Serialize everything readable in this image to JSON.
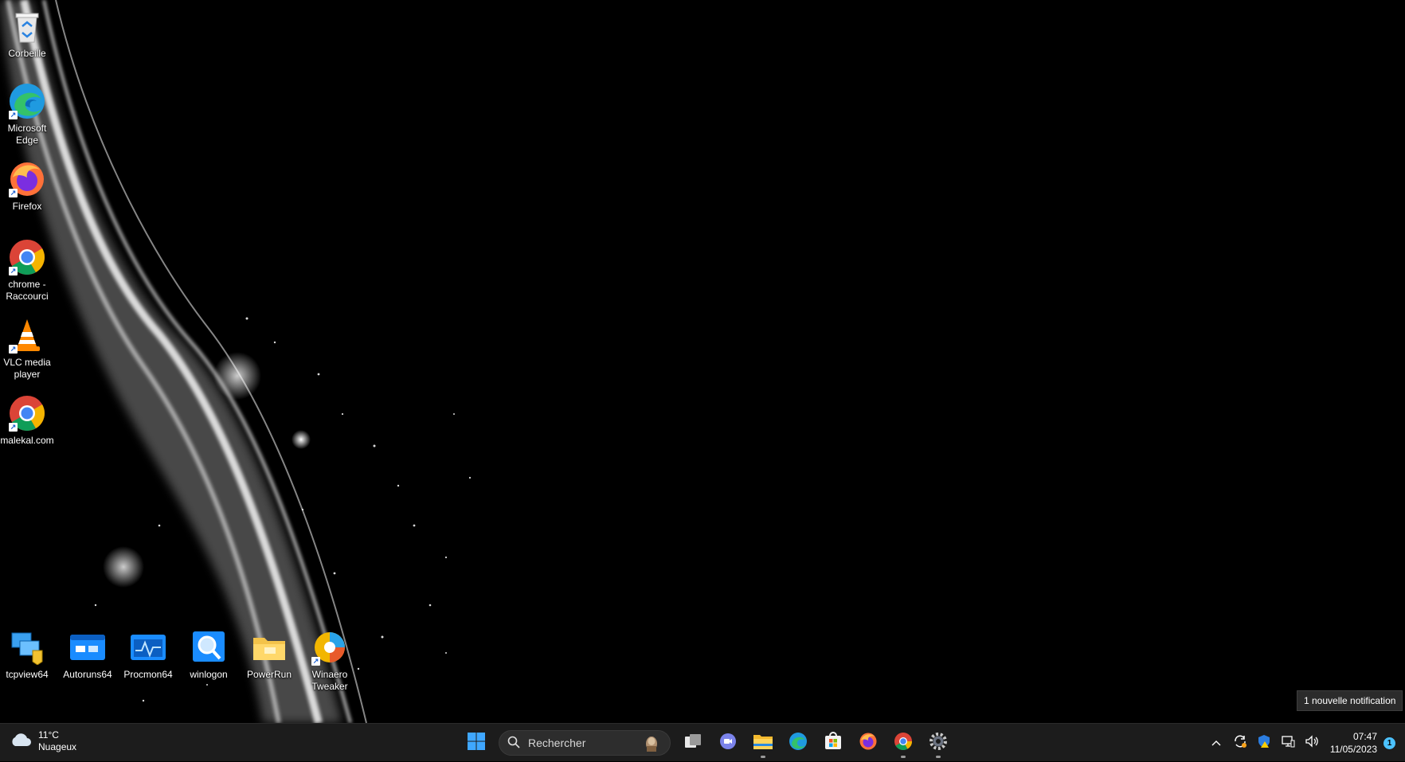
{
  "desktop_icons": [
    {
      "label": "Corbeille",
      "icon": "recycle-bin-icon"
    },
    {
      "label": "Microsoft Edge",
      "icon": "edge-icon"
    },
    {
      "label": "Firefox",
      "icon": "firefox-icon"
    },
    {
      "label": "chrome - Raccourci",
      "icon": "chrome-icon"
    },
    {
      "label": "VLC media player",
      "icon": "vlc-icon"
    },
    {
      "label": "malekal.com",
      "icon": "chrome-icon"
    }
  ],
  "desktop_icons_bottom": [
    {
      "label": "tcpview64",
      "icon": "tcpview-icon"
    },
    {
      "label": "Autoruns64",
      "icon": "autoruns-icon"
    },
    {
      "label": "Procmon64",
      "icon": "procmon-icon"
    },
    {
      "label": "winlogon",
      "icon": "search-icon"
    },
    {
      "label": "PowerRun",
      "icon": "folder-icon"
    },
    {
      "label": "Winaero Tweaker",
      "icon": "winaero-icon"
    }
  ],
  "taskbar": {
    "weather": {
      "temp": "11°C",
      "condition": "Nuageux",
      "icon": "cloud-icon"
    },
    "search_placeholder": "Rechercher",
    "pinned": [
      "start-icon",
      "task-view-icon",
      "teams-chat-icon",
      "file-explorer-icon",
      "edge-icon",
      "store-icon",
      "firefox-icon",
      "chrome-icon",
      "settings-icon"
    ],
    "tray": {
      "time": "07:47",
      "date": "11/05/2023",
      "notification_count": "1"
    }
  },
  "toast": {
    "text": "1 nouvelle notification"
  },
  "colors": {
    "taskbar": "#1c1c1c",
    "accent": "#4cc2ff",
    "desktop": "#000000"
  }
}
